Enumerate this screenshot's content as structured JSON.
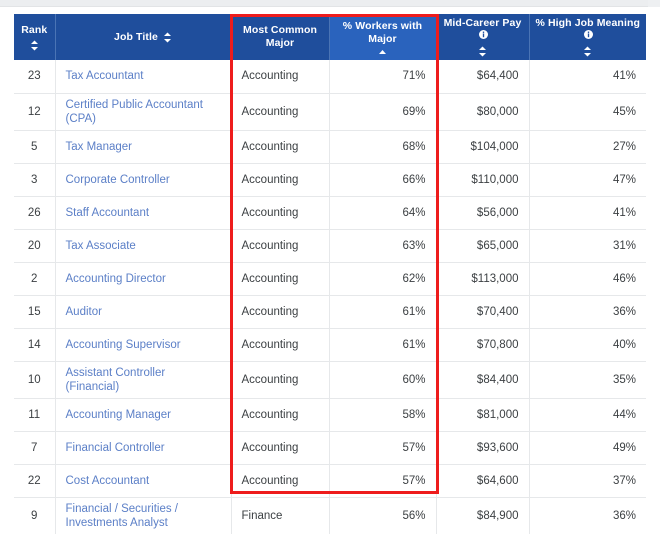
{
  "table": {
    "columns": [
      {
        "key": "rank",
        "label": "Rank",
        "sortable": true,
        "sort_state": "none",
        "info": false,
        "align": "center"
      },
      {
        "key": "title",
        "label": "Job Title",
        "sortable": true,
        "sort_state": "none",
        "info": false,
        "align": "left"
      },
      {
        "key": "major",
        "label": "Most Common Major",
        "sortable": false,
        "sort_state": "none",
        "info": false,
        "align": "left"
      },
      {
        "key": "pct",
        "label": "% Workers with Major",
        "sortable": true,
        "sort_state": "desc",
        "info": false,
        "align": "right"
      },
      {
        "key": "pay",
        "label": "Mid-Career Pay",
        "sortable": true,
        "sort_state": "none",
        "info": true,
        "align": "right"
      },
      {
        "key": "meaning",
        "label": "% High Job Meaning",
        "sortable": true,
        "sort_state": "none",
        "info": true,
        "align": "right"
      }
    ],
    "rows": [
      {
        "rank": "23",
        "title": "Tax Accountant",
        "major": "Accounting",
        "pct": "71%",
        "pay": "$64,400",
        "meaning": "41%"
      },
      {
        "rank": "12",
        "title": "Certified Public Accountant (CPA)",
        "major": "Accounting",
        "pct": "69%",
        "pay": "$80,000",
        "meaning": "45%"
      },
      {
        "rank": "5",
        "title": "Tax Manager",
        "major": "Accounting",
        "pct": "68%",
        "pay": "$104,000",
        "meaning": "27%"
      },
      {
        "rank": "3",
        "title": "Corporate Controller",
        "major": "Accounting",
        "pct": "66%",
        "pay": "$110,000",
        "meaning": "47%"
      },
      {
        "rank": "26",
        "title": "Staff Accountant",
        "major": "Accounting",
        "pct": "64%",
        "pay": "$56,000",
        "meaning": "41%"
      },
      {
        "rank": "20",
        "title": "Tax Associate",
        "major": "Accounting",
        "pct": "63%",
        "pay": "$65,000",
        "meaning": "31%"
      },
      {
        "rank": "2",
        "title": "Accounting Director",
        "major": "Accounting",
        "pct": "62%",
        "pay": "$113,000",
        "meaning": "46%"
      },
      {
        "rank": "15",
        "title": "Auditor",
        "major": "Accounting",
        "pct": "61%",
        "pay": "$70,400",
        "meaning": "36%"
      },
      {
        "rank": "14",
        "title": "Accounting Supervisor",
        "major": "Accounting",
        "pct": "61%",
        "pay": "$70,800",
        "meaning": "40%"
      },
      {
        "rank": "10",
        "title": "Assistant Controller (Financial)",
        "major": "Accounting",
        "pct": "60%",
        "pay": "$84,400",
        "meaning": "35%"
      },
      {
        "rank": "11",
        "title": "Accounting Manager",
        "major": "Accounting",
        "pct": "58%",
        "pay": "$81,000",
        "meaning": "44%"
      },
      {
        "rank": "7",
        "title": "Financial Controller",
        "major": "Accounting",
        "pct": "57%",
        "pay": "$93,600",
        "meaning": "49%"
      },
      {
        "rank": "22",
        "title": "Cost Accountant",
        "major": "Accounting",
        "pct": "57%",
        "pay": "$64,600",
        "meaning": "37%"
      },
      {
        "rank": "9",
        "title": "Financial / Securities / Investments Analyst",
        "major": "Finance",
        "pct": "56%",
        "pay": "$84,900",
        "meaning": "36%"
      }
    ]
  },
  "annotation": {
    "type": "highlight-rectangle",
    "color": "#ee1c1c",
    "covers_columns": [
      "Most Common Major",
      "% Workers with Major"
    ]
  },
  "colors": {
    "header_bg": "#1f4e9c",
    "header_sorted_bg": "#2a63bd",
    "link": "#5b7fc7",
    "text": "#3c4043",
    "grid": "#e6e8ea",
    "annotation": "#ee1c1c"
  }
}
